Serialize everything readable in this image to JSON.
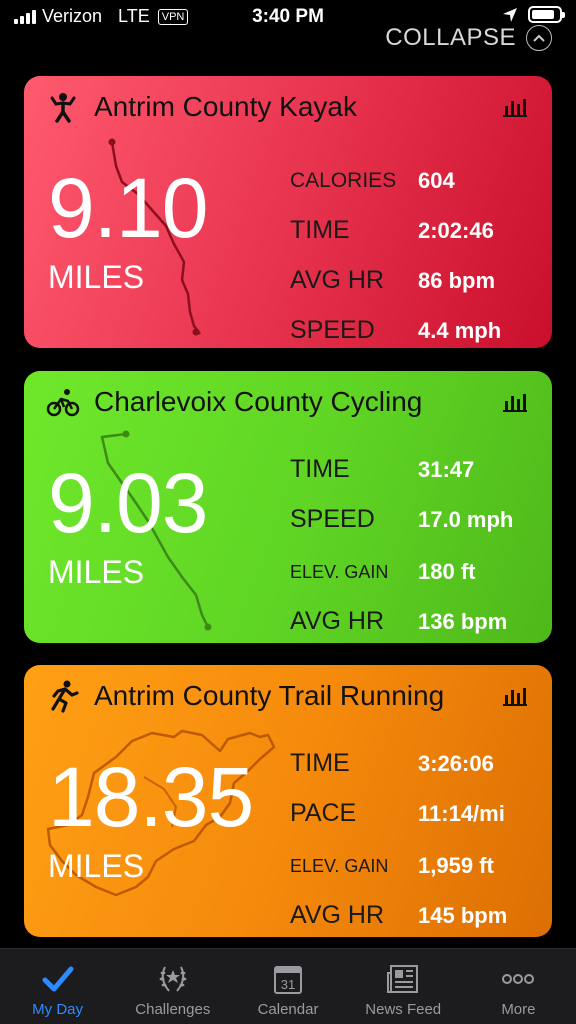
{
  "status_bar": {
    "carrier": "Verizon",
    "network": "LTE",
    "vpn": "VPN",
    "time": "3:40 PM"
  },
  "collapse_label": "COLLAPSE",
  "activities": [
    {
      "title": "Antrim County Kayak",
      "icon": "kayak-icon",
      "distance": "9.10",
      "unit": "MILES",
      "metrics": [
        {
          "label": "CALORIES",
          "value": "604"
        },
        {
          "label": "TIME",
          "value": "2:02:46"
        },
        {
          "label": "AVG HR",
          "value": "86 bpm"
        },
        {
          "label": "SPEED",
          "value": "4.4 mph"
        }
      ]
    },
    {
      "title": "Charlevoix County Cycling",
      "icon": "cycling-icon",
      "distance": "9.03",
      "unit": "MILES",
      "metrics": [
        {
          "label": "TIME",
          "value": "31:47"
        },
        {
          "label": "SPEED",
          "value": "17.0 mph"
        },
        {
          "label": "ELEV. GAIN",
          "value": "180 ft"
        },
        {
          "label": "AVG HR",
          "value": "136 bpm"
        }
      ]
    },
    {
      "title": "Antrim County Trail Running",
      "icon": "running-icon",
      "distance": "18.35",
      "unit": "MILES",
      "metrics": [
        {
          "label": "TIME",
          "value": "3:26:06"
        },
        {
          "label": "PACE",
          "value": "11:14/mi"
        },
        {
          "label": "ELEV. GAIN",
          "value": "1,959 ft"
        },
        {
          "label": "AVG HR",
          "value": "145 bpm"
        }
      ]
    }
  ],
  "tabs": [
    {
      "label": "My Day",
      "icon": "checkmark-icon",
      "active": true
    },
    {
      "label": "Challenges",
      "icon": "laurel-icon",
      "active": false
    },
    {
      "label": "Calendar",
      "icon": "calendar-icon",
      "day": "31",
      "active": false
    },
    {
      "label": "News Feed",
      "icon": "newspaper-icon",
      "active": false
    },
    {
      "label": "More",
      "icon": "more-dots-icon",
      "active": false
    }
  ],
  "colors": {
    "kayak": "#e8344f",
    "cycling": "#5fd424",
    "running": "#f58a0c",
    "accent": "#2e8bff"
  }
}
